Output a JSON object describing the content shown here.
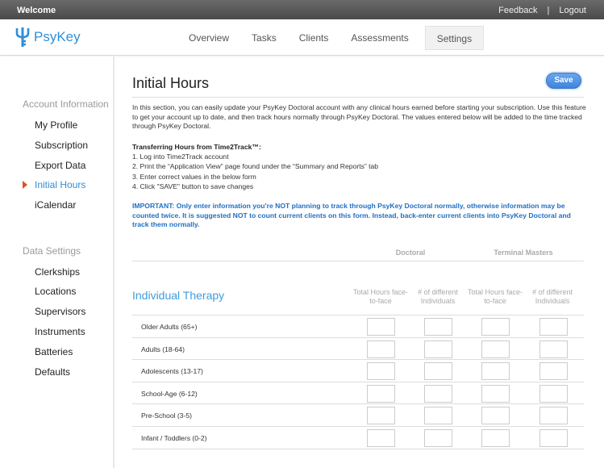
{
  "topbar": {
    "welcome": "Welcome",
    "feedback": "Feedback",
    "separator": "|",
    "logout": "Logout"
  },
  "logo": {
    "name": "PsyKey",
    "icon": "trident-key-icon",
    "color": "#2f8fd8"
  },
  "nav": {
    "tabs": [
      "Overview",
      "Tasks",
      "Clients",
      "Assessments",
      "Settings"
    ],
    "active": "Settings"
  },
  "sidebar": {
    "account_heading": "Account Information",
    "account_items": [
      "My Profile",
      "Subscription",
      "Export Data",
      "Initial Hours",
      "iCalendar"
    ],
    "active_item": "Initial Hours",
    "data_heading": "Data Settings",
    "data_items": [
      "Clerkships",
      "Locations",
      "Supervisors",
      "Instruments",
      "Batteries",
      "Defaults"
    ]
  },
  "main": {
    "title": "Initial Hours",
    "save_label": "Save",
    "intro": "In this section, you can easily update your PsyKey Doctoral account with any clinical hours earned before starting your subscription. Use this feature to get your account up to date, and then track hours normally through PsyKey Doctoral. The values entered below will be added to the time tracked through PsyKey Doctoral.",
    "steps_heading": "Transferring Hours from Time2Track™:",
    "steps": [
      "1. Log into Time2Track account",
      "2. Print the “Application View” page found under the “Summary and Reports” tab",
      "3. Enter correct values in the below form",
      "4. Click \"SAVE\" button to save changes"
    ],
    "important": "IMPORTANT: Only enter information you're NOT planning to track through PsyKey Doctoral normally, otherwise information may be counted twice. It is suggested NOT to count current clients on this form. Instead, back-enter current clients into PsyKey Doctoral and track them normally.",
    "groups": [
      "Doctoral",
      "Terminal Masters"
    ],
    "section_title": "Individual Therapy",
    "columns": [
      "Total Hours face-to-face",
      "# of different Individuals",
      "Total Hours face-to-face",
      "# of different Individuals"
    ],
    "rows": [
      {
        "label": "Older Adults (65+)",
        "values": [
          "",
          "",
          "",
          ""
        ]
      },
      {
        "label": "Adults (18-64)",
        "values": [
          "",
          "",
          "",
          ""
        ]
      },
      {
        "label": "Adolescents (13-17)",
        "values": [
          "",
          "",
          "",
          ""
        ]
      },
      {
        "label": "School-Age (6-12)",
        "values": [
          "",
          "",
          "",
          ""
        ]
      },
      {
        "label": "Pre-School (3-5)",
        "values": [
          "",
          "",
          "",
          ""
        ]
      },
      {
        "label": "Infant / Toddlers (0-2)",
        "values": [
          "",
          "",
          "",
          ""
        ]
      }
    ]
  },
  "colors": {
    "accent": "#2f8fd8",
    "important": "#1f6fc4",
    "active_arrow": "#d9541e",
    "save": "#4a8fe2"
  }
}
